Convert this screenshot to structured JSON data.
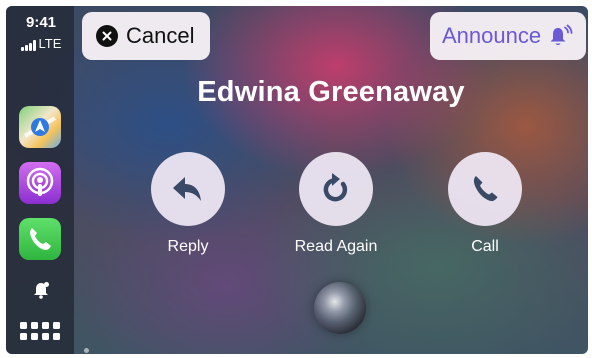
{
  "status": {
    "time": "9:41",
    "network": "LTE"
  },
  "sidebar": {
    "apps": [
      {
        "name": "Maps",
        "icon": "maps-icon"
      },
      {
        "name": "Podcasts",
        "icon": "podcasts-icon"
      },
      {
        "name": "Phone",
        "icon": "phone-icon"
      }
    ],
    "notification_icon": "bell-icon",
    "dashboard_icon": "app-grid-icon"
  },
  "top_bar": {
    "cancel_label": "Cancel",
    "announce_label": "Announce"
  },
  "message": {
    "sender": "Edwina Greenaway"
  },
  "actions": [
    {
      "label": "Reply",
      "icon": "reply-arrow-icon"
    },
    {
      "label": "Read Again",
      "icon": "replay-icon"
    },
    {
      "label": "Call",
      "icon": "phone-handset-icon"
    }
  ],
  "colors": {
    "accent": "#6a5ad6",
    "action_icon": "#3a4a66",
    "cancel_x": "#111111"
  }
}
